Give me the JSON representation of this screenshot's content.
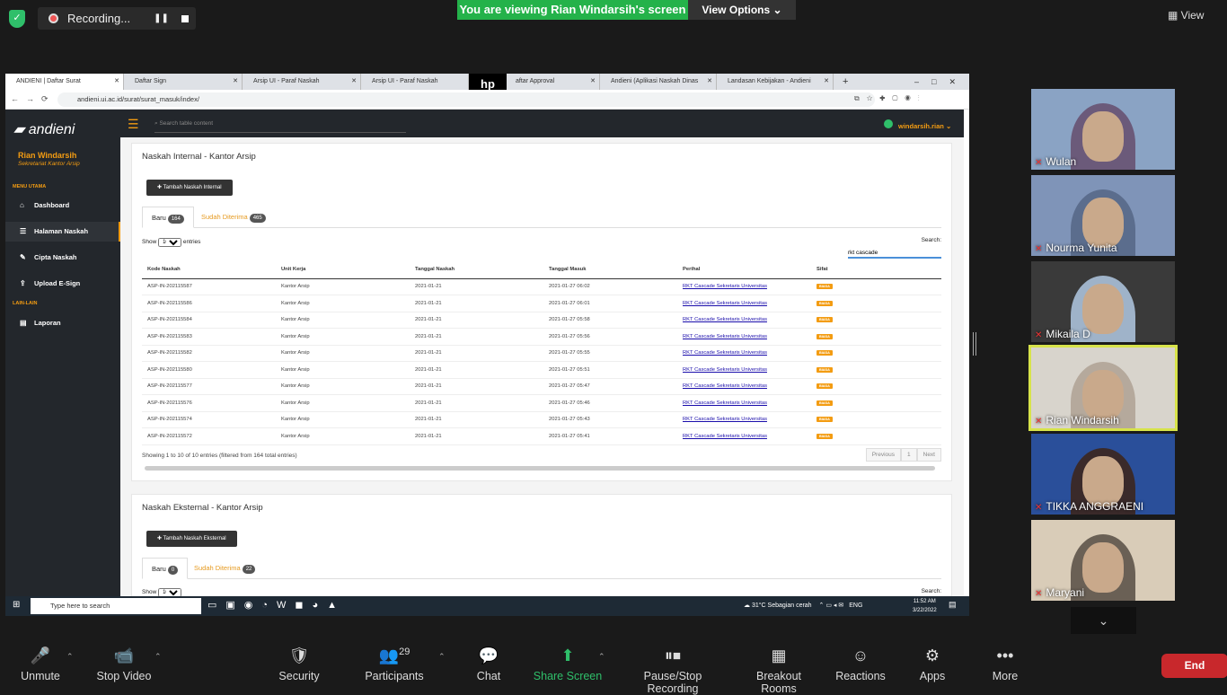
{
  "zoom": {
    "recording": "Recording...",
    "viewing": "You are viewing Rian Windarsih's screen",
    "view_options": "View Options",
    "view": "View",
    "participants_count": "29",
    "end": "End",
    "bottom": [
      {
        "label": "Unmute",
        "glyph": "🎤"
      },
      {
        "label": "Stop Video",
        "glyph": "📹"
      },
      {
        "label": "Security",
        "glyph": "🛡"
      },
      {
        "label": "Participants",
        "glyph": "👥"
      },
      {
        "label": "Chat",
        "glyph": "💬"
      },
      {
        "label": "Share Screen",
        "glyph": "⬆"
      },
      {
        "label": "Pause/Stop Recording",
        "glyph": "⏸⏹"
      },
      {
        "label": "Breakout Rooms",
        "glyph": "▦"
      },
      {
        "label": "Reactions",
        "glyph": "☺"
      },
      {
        "label": "Apps",
        "glyph": "⚙"
      },
      {
        "label": "More",
        "glyph": "•••"
      }
    ],
    "gallery": [
      {
        "name": "Wulan",
        "bg": "#8aa3c4",
        "hijab": "#6b5a7a"
      },
      {
        "name": "Nourma Yunita",
        "bg": "#7f94b8",
        "hijab": "#5b6d8d"
      },
      {
        "name": "Mikaila D",
        "bg": "#3a3a3a",
        "hijab": "#9fb3c9"
      },
      {
        "name": "Rian Windarsih",
        "bg": "#d8d4cc",
        "hijab": "#b5a99c"
      },
      {
        "name": "TIKKA ANGGRAENI",
        "bg": "#2a4f9a",
        "hijab": "#3a2a2a"
      },
      {
        "name": "Maryani",
        "bg": "#d9ccb8",
        "hijab": "#6a6055"
      }
    ]
  },
  "browser": {
    "tabs": [
      "ANDIENI | Daftar Surat",
      "Daftar Sign",
      "Arsip UI - Paraf Naskah",
      "Arsip UI - Paraf Naskah",
      "aftar Approval",
      "Andieni (Aplikasi Naskah Dinas",
      "Landasan Kebijakan - Andieni"
    ],
    "url": "andieni.ui.ac.id/surat/surat_masuk/index/",
    "hp": "hp"
  },
  "app": {
    "logo": "andieni",
    "user": "Rian Windarsih",
    "role": "Sekretariat Kantor Arsip",
    "menu_utama": "MENU UTAMA",
    "lain": "LAIN-LAIN",
    "menu": [
      "Dashboard",
      "Halaman Naskah",
      "Cipta Naskah",
      "Upload E-Sign"
    ],
    "menu2": [
      "Laporan"
    ],
    "search_placeholder": "Search table content",
    "top_user": "windarsih.rian"
  },
  "internal": {
    "title": "Naskah Internal - Kantor Arsip",
    "add": "✚ Tambah Naskah Internal",
    "tab_new": "Baru",
    "tab_new_count": "164",
    "tab_done": "Sudah Diterima",
    "tab_done_count": "465",
    "show": "Show",
    "entries": "entries",
    "entries_val": "10",
    "search_label": "Search:",
    "search_value": "rkt cascade",
    "headers": [
      "Kode Naskah",
      "Unit Kerja",
      "Tanggal Naskah",
      "Tanggal Masuk",
      "Perihal",
      "Sifat"
    ],
    "rows": [
      [
        "ASP-IN-202115587",
        "Kantor Arsip",
        "2021-01-21",
        "2021-01-27 06:02",
        "RKT Cascade Sekretaris Universitas",
        "BIASA"
      ],
      [
        "ASP-IN-202115586",
        "Kantor Arsip",
        "2021-01-21",
        "2021-01-27 06:01",
        "RKT Cascade Sekretaris Universitas",
        "BIASA"
      ],
      [
        "ASP-IN-202115584",
        "Kantor Arsip",
        "2021-01-21",
        "2021-01-27 05:58",
        "RKT Cascade Sekretaris Universitas",
        "BIASA"
      ],
      [
        "ASP-IN-202115583",
        "Kantor Arsip",
        "2021-01-21",
        "2021-01-27 05:56",
        "RKT Cascade Sekretaris Universitas",
        "BIASA"
      ],
      [
        "ASP-IN-202115582",
        "Kantor Arsip",
        "2021-01-21",
        "2021-01-27 05:55",
        "RKT Cascade Sekretaris Universitas",
        "BIASA"
      ],
      [
        "ASP-IN-202115580",
        "Kantor Arsip",
        "2021-01-21",
        "2021-01-27 05:51",
        "RKT Cascade Sekretaris Universitas",
        "BIASA"
      ],
      [
        "ASP-IN-202115577",
        "Kantor Arsip",
        "2021-01-21",
        "2021-01-27 05:47",
        "RKT Cascade Sekretaris Universitas",
        "BIASA"
      ],
      [
        "ASP-IN-202115576",
        "Kantor Arsip",
        "2021-01-21",
        "2021-01-27 05:46",
        "RKT Cascade Sekretaris Universitas",
        "BIASA"
      ],
      [
        "ASP-IN-202115574",
        "Kantor Arsip",
        "2021-01-21",
        "2021-01-27 05:43",
        "RKT Cascade Sekretaris Universitas",
        "BIASA"
      ],
      [
        "ASP-IN-202115572",
        "Kantor Arsip",
        "2021-01-21",
        "2021-01-27 05:41",
        "RKT Cascade Sekretaris Universitas",
        "BIASA"
      ]
    ],
    "info": "Showing 1 to 10 of 10 entries (filtered from 164 total entries)",
    "prev": "Previous",
    "page": "1",
    "next": "Next"
  },
  "external": {
    "title": "Naskah Eksternal - Kantor Arsip",
    "add": "✚ Tambah Naskah Eksternal",
    "tab_new": "Baru",
    "tab_new_count": "0",
    "tab_done": "Sudah Diterima",
    "tab_done_count": "22",
    "show": "Show",
    "entries_val": "10",
    "search_label": "Search:"
  },
  "taskbar": {
    "search": "Type here to search",
    "weather": "31°C  Sebagian cerah",
    "lang": "ENG",
    "time": "11:52 AM",
    "date": "3/22/2022"
  }
}
